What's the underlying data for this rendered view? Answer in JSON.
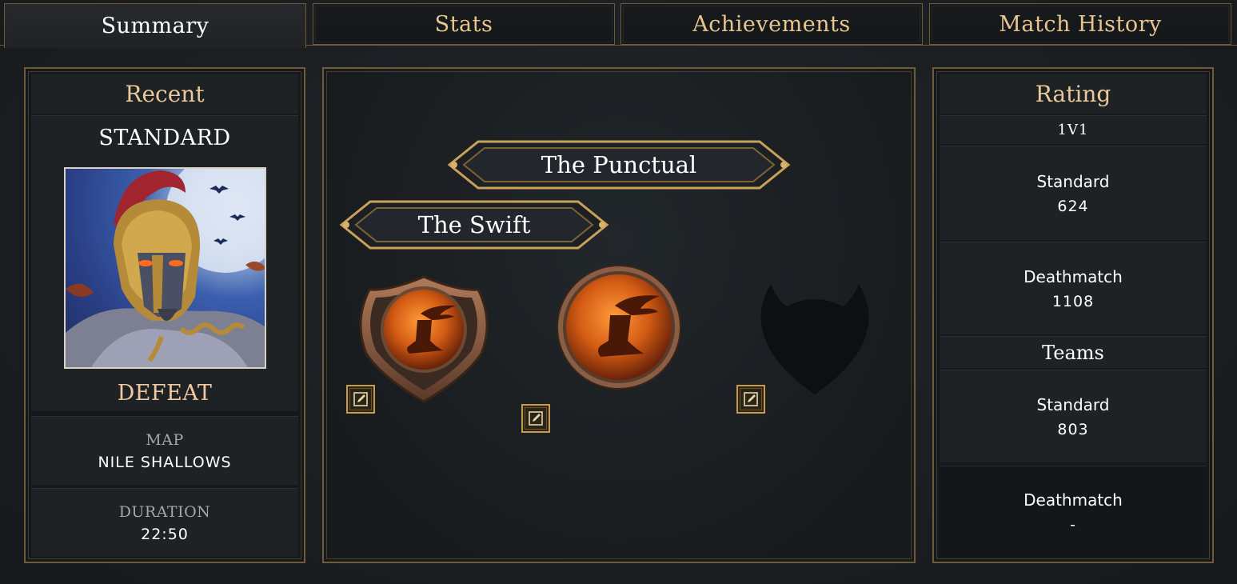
{
  "tabs": [
    {
      "label": "Summary",
      "active": true
    },
    {
      "label": "Stats",
      "active": false
    },
    {
      "label": "Achievements",
      "active": false
    },
    {
      "label": "Match History",
      "active": false
    }
  ],
  "recent": {
    "heading": "Recent",
    "mode": "STANDARD",
    "result": "DEFEAT",
    "map_label": "MAP",
    "map_value": "NILE SHALLOWS",
    "duration_label": "DURATION",
    "duration_value": "22:50"
  },
  "titles": {
    "primary": "The Punctual",
    "secondary": "The Swift"
  },
  "emblems": [
    {
      "icon": "winged-sandal-icon",
      "frame": "shield"
    },
    {
      "icon": "winged-sandal-icon",
      "frame": "circle"
    },
    {
      "icon": "empty-crest-icon",
      "frame": "locked"
    }
  ],
  "rating": {
    "heading": "Rating",
    "group1_label": "1V1",
    "group1": [
      {
        "label": "Standard",
        "value": "624"
      },
      {
        "label": "Deathmatch",
        "value": "1108"
      }
    ],
    "group2_label": "Teams",
    "group2": [
      {
        "label": "Standard",
        "value": "803"
      },
      {
        "label": "Deathmatch",
        "value": "-"
      }
    ]
  },
  "colors": {
    "gold": "#e7c58d",
    "border": "#6e5b3c",
    "emblem_orange": "#e0701c"
  }
}
